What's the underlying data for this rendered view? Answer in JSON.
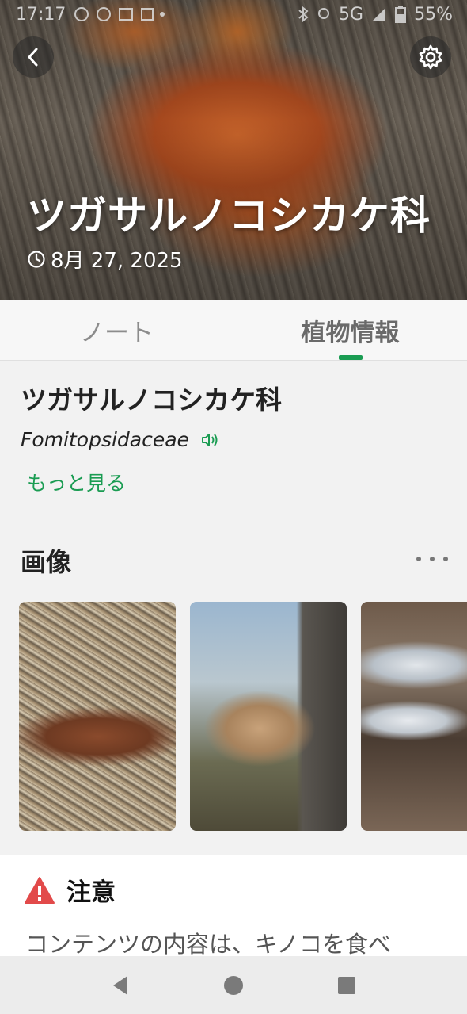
{
  "status_bar": {
    "time": "17:17",
    "network": "5G",
    "battery": "55%"
  },
  "header": {
    "title": "ツガサルノコシカケ科",
    "date": "8月 27, 2025"
  },
  "tabs": [
    {
      "label": "ノート",
      "active": false
    },
    {
      "label": "植物情報",
      "active": true
    }
  ],
  "plant": {
    "name": "ツガサルノコシカケ科",
    "scientific_name": "Fomitopsidaceae",
    "more_label": "もっと見る"
  },
  "images_section": {
    "title": "画像"
  },
  "warning": {
    "title": "注意",
    "text": "コンテンツの内容は、キノコを食べ"
  },
  "colors": {
    "accent": "#1a9c52",
    "warning": "#e24a4a"
  }
}
